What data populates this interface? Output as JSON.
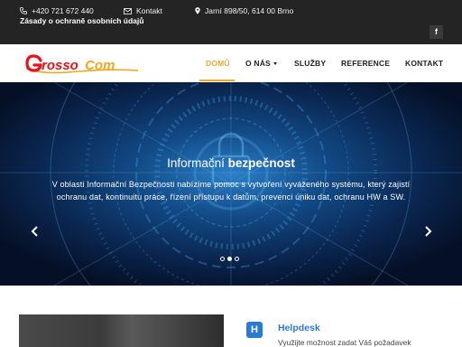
{
  "topbar": {
    "phone": "+420 721 672 440",
    "email_label": "Kontakt",
    "address": "Jarní 898/50, 614 00 Brno",
    "privacy_link": "Zásady o ochraně osobních údajů",
    "social": {
      "facebook_label": "f",
      "icon": "facebook-icon"
    }
  },
  "brand": {
    "logo_text_first": "rosso",
    "logo_text_second": "Com",
    "logo_initial": "G",
    "colors": {
      "red": "#e3141b",
      "orange": "#f0a91a"
    }
  },
  "nav": {
    "items": [
      {
        "label": "DOMŮ",
        "active": true
      },
      {
        "label": "O NÁS",
        "dropdown": true
      },
      {
        "label": "SLUŽBY"
      },
      {
        "label": "REFERENCE"
      },
      {
        "label": "KONTAKT"
      }
    ],
    "active_color": "#f0a91a"
  },
  "hero": {
    "title_regular": "Informační",
    "title_bold": "bezpečnost",
    "text": "V oblasti Informační Bezpečnosti nabízíme pomoc s vytvoření vyváženého systému, který zajistí ochranu dat, kontinuitu práce, řízení přístupu k datům, prevenci úniku dat, ochranu HW a SW.",
    "slides_count": 3,
    "active_slide": 2,
    "icons": {
      "prev": "chevron-left-icon",
      "next": "chevron-right-icon"
    }
  },
  "helpdesk": {
    "icon_letter": "H",
    "title": "Helpdesk",
    "text": "Využijte možnost zadat Váš požadavek",
    "color": "#2a7bd3"
  }
}
